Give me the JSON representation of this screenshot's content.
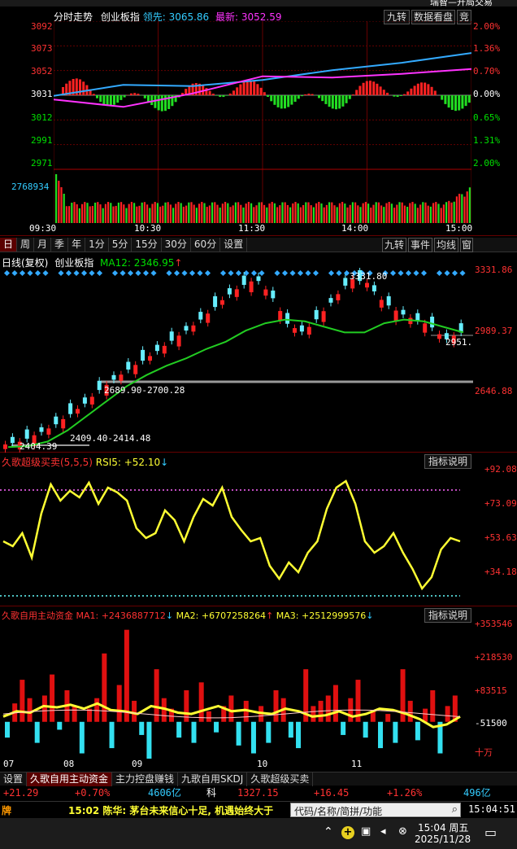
{
  "titlebar": {
    "text": "瑞智—开局交易"
  },
  "intraday": {
    "title": "分时走势",
    "index_name": "创业板指",
    "lead_label": "领先:",
    "lead_value": "3065.86",
    "latest_label": "最新:",
    "latest_value": "3052.59",
    "buttons": [
      "九转",
      "数据看盘",
      "竞"
    ],
    "price_ticks": [
      "3092",
      "3073",
      "3052",
      "3031",
      "3012",
      "2991",
      "2971"
    ],
    "pct_ticks": [
      "2.00%",
      "1.36%",
      "0.70%",
      "0.00%",
      "0.65%",
      "1.31%",
      "2.00%"
    ],
    "volume_label": "2768934",
    "time_ticks": [
      "09:30",
      "10:30",
      "11:30",
      "14:00",
      "15:00"
    ],
    "chart_data": {
      "type": "line",
      "x": [
        "09:30",
        "10:30",
        "11:30",
        "14:00",
        "15:00"
      ],
      "ylim": [
        2971,
        3092
      ],
      "series": [
        {
          "name": "领先",
          "color": "#33aaff",
          "values": [
            3031,
            3040,
            3039,
            3044,
            3052,
            3058,
            3066
          ]
        },
        {
          "name": "最新",
          "color": "#ff33ff",
          "values": [
            3028,
            3022,
            3033,
            3047,
            3046,
            3049,
            3053
          ]
        }
      ]
    }
  },
  "periods": {
    "tabs": [
      "日",
      "周",
      "月",
      "季",
      "年",
      "1分",
      "5分",
      "15分",
      "30分",
      "60分",
      "设置"
    ],
    "active": "日",
    "right_buttons": [
      "九转",
      "事件",
      "均线",
      "窗"
    ]
  },
  "kline": {
    "title": "日线(复权)",
    "index_name": "创业板指",
    "ma_label": "MA12: 2346.95",
    "price_ticks": [
      "3331.86",
      "2989.37",
      "2646.88"
    ],
    "annot_high": "3331.80",
    "annot_current": "2951.",
    "annot_line1": "2689.90-2700.28",
    "annot_line2": "2409.40-2414.48",
    "annot_low": "2404.39",
    "chart_data": {
      "type": "line",
      "ylim": [
        2360,
        3360
      ],
      "series": [
        {
          "name": "MA12",
          "color": "#22cc22",
          "values": [
            2390,
            2395,
            2420,
            2480,
            2560,
            2640,
            2720,
            2780,
            2830,
            2870,
            2920,
            2960,
            3020,
            3060,
            3080,
            3070,
            3040,
            3010,
            3010,
            3060,
            3080,
            3070,
            3040,
            3010
          ]
        }
      ]
    }
  },
  "rsi": {
    "title": "久歌超级买卖(5,5,5)",
    "value_label": "RSI5: +52.10",
    "explain_button": "指标说明",
    "ticks": [
      "+92.08",
      "+73.09",
      "+53.63",
      "+34.18"
    ],
    "chart_data": {
      "type": "line",
      "ylim": [
        15,
        100
      ],
      "series": [
        {
          "name": "RSI5",
          "color": "#ffff33",
          "values": [
            55,
            52,
            60,
            45,
            72,
            90,
            80,
            86,
            82,
            91,
            78,
            88,
            85,
            80,
            63,
            57,
            60,
            74,
            68,
            55,
            70,
            81,
            77,
            88,
            70,
            62,
            55,
            57,
            40,
            32,
            42,
            36,
            48,
            55,
            75,
            88,
            92,
            78,
            55,
            48,
            52,
            60,
            48,
            38,
            26,
            33,
            50,
            57,
            55
          ]
        }
      ]
    }
  },
  "fund": {
    "title": "久歌自用主动资金",
    "ma1": "MA1: +2436887712",
    "ma2": "MA2: +6707258264",
    "ma3": "MA3: +2512999576",
    "explain_button": "指标说明",
    "ticks": [
      "+353546",
      "+218530",
      "+83515",
      "-51500"
    ],
    "unit": "十万",
    "month_labels": [
      "07",
      "08",
      "09",
      "10",
      "11"
    ],
    "chart_data": {
      "type": "bar",
      "ylim": [
        -140000,
        380000
      ],
      "values": [
        -60000,
        70000,
        160000,
        90000,
        -80000,
        100000,
        180000,
        -30000,
        120000,
        60000,
        -120000,
        50000,
        90000,
        260000,
        -100000,
        140000,
        350000,
        80000,
        -50000,
        -140000,
        200000,
        90000,
        50000,
        -60000,
        120000,
        -80000,
        150000,
        40000,
        -40000,
        60000,
        100000,
        -90000,
        80000,
        -120000,
        60000,
        -80000,
        120000,
        90000,
        -60000,
        -100000,
        200000,
        60000,
        80000,
        100000,
        140000,
        -50000,
        90000,
        160000,
        -60000,
        40000,
        -100000,
        30000,
        -80000,
        200000,
        80000,
        -70000,
        50000,
        120000,
        -120000,
        60000,
        100000
      ]
    }
  },
  "bottom_tabs": [
    "设置",
    "久歌自用主动资金",
    "主力控盘赚钱",
    "九歌自用SKDJ",
    "久歌超级买卖"
  ],
  "quote_bar": {
    "chg": "+21.29",
    "pct": "+0.70%",
    "amount": "4606亿",
    "name": "科",
    "price": "1327.15",
    "chg2": "+16.45",
    "pct2": "+1.26%",
    "amount2": "496亿"
  },
  "news_bar": {
    "tag": "牌",
    "news": "15:02 陈华: 茅台未来信心十足, 机遇始终大于",
    "search_placeholder": "代码/名称/简拼/功能",
    "clock": "15:04:51"
  },
  "taskbar": {
    "time": "15:04 周五",
    "date": "2025/11/28"
  }
}
